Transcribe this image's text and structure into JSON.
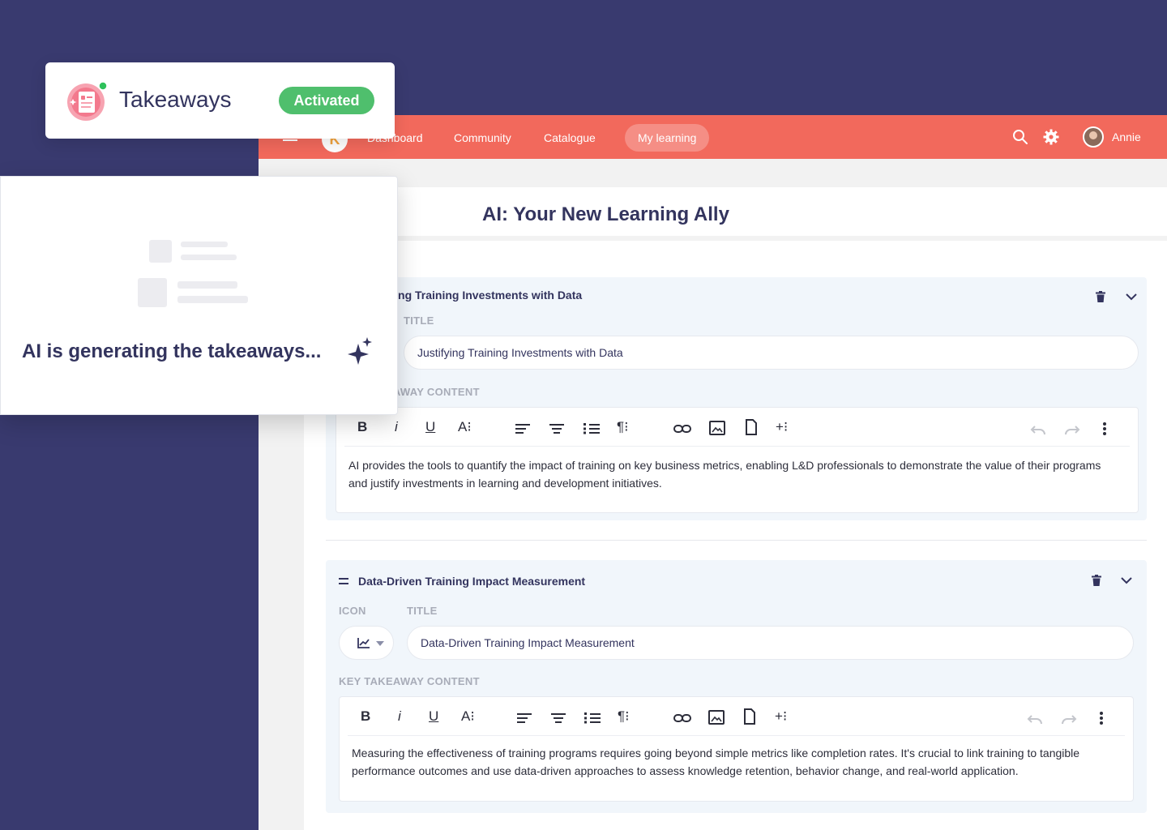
{
  "nav": {
    "items": [
      "Dashboard",
      "Community",
      "Catalogue",
      "My learning"
    ],
    "active": "My learning",
    "user_name": "Annie",
    "logo_letter": "K",
    "icons": [
      "menu-icon",
      "search-icon",
      "gear-icon"
    ]
  },
  "page": {
    "title": "AI: Your New Learning Ally"
  },
  "cards": [
    {
      "header_title": "Justifying Training Investments with Data",
      "title_label": "TITLE",
      "title_value": "Justifying Training Investments with Data",
      "content_label": "KEY TAKEAWAY CONTENT",
      "content": "AI provides the tools to quantify the impact of training on key business metrics, enabling L&D professionals to demonstrate the value of their programs and justify investments in learning and development initiatives."
    },
    {
      "header_title": "Data-Driven Training Impact Measurement",
      "icon_label": "ICON",
      "title_label": "TITLE",
      "title_value": "Data-Driven Training Impact Measurement",
      "content_label": "KEY TAKEAWAY CONTENT",
      "content": "Measuring the effectiveness of training programs requires going beyond simple metrics like completion rates. It's crucial to link training to tangible performance outcomes and use data-driven approaches to assess knowledge retention, behavior change, and real-world application."
    }
  ],
  "toolbar": {
    "bold": "B",
    "italic": "i",
    "underline": "U",
    "font": "A⁝",
    "paragraph": "¶⁝",
    "insert": "+⁝"
  },
  "takeaways": {
    "title": "Takeaways",
    "status": "Activated"
  },
  "generating": {
    "text": "AI is generating the takeaways..."
  },
  "colors": {
    "background": "#393a6f",
    "nav": "#f2695c",
    "badge": "#4fbf6d",
    "text": "#33345e"
  }
}
